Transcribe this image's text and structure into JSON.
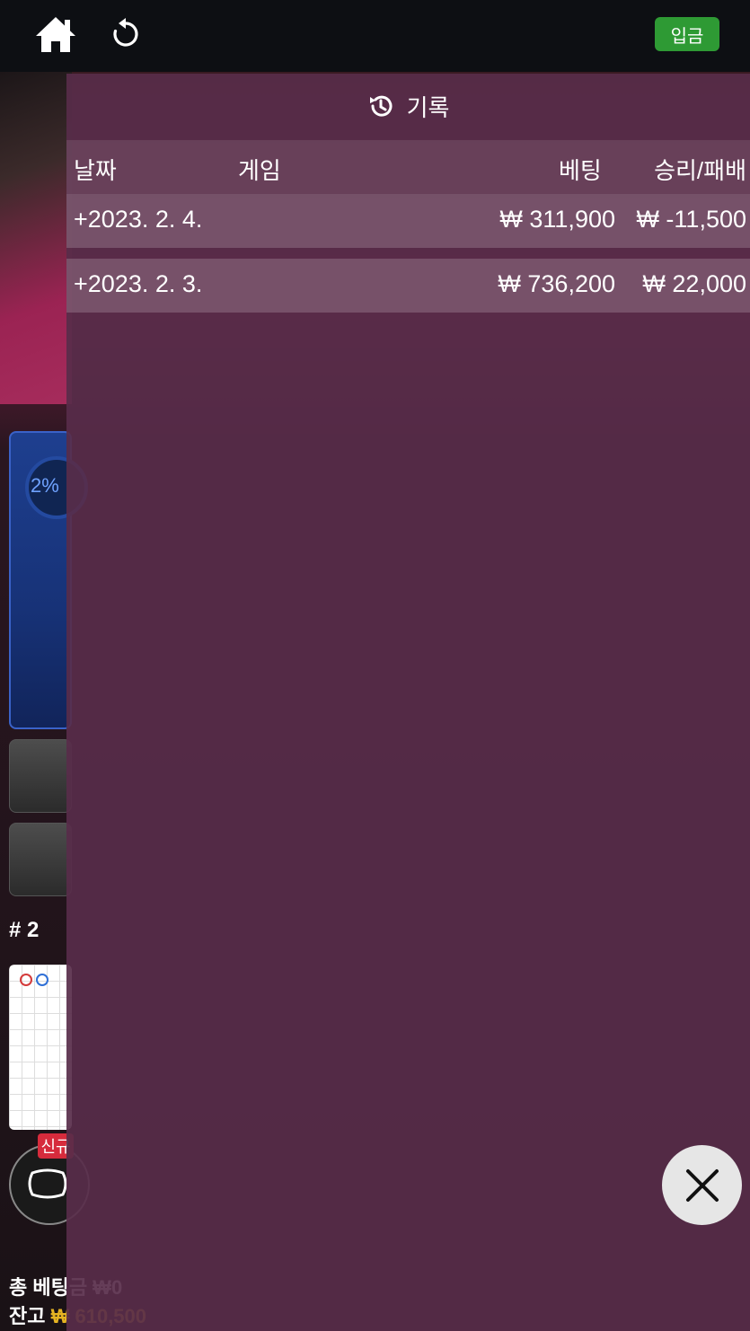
{
  "topbar": {
    "home_icon": "home-icon",
    "refresh_icon": "refresh-icon",
    "deposit_label": "입금",
    "deposit_color": "#2e9a34"
  },
  "background": {
    "player_percent": "2%",
    "round_label": "# 2",
    "new_badge": "신규",
    "total_bet_label": "총 베팅금 ₩0",
    "balance_label": "잔고",
    "balance_value": "₩ 610,500"
  },
  "history": {
    "title": "기록",
    "title_icon": "history-icon",
    "columns": {
      "date": "날짜",
      "game": "게임",
      "bet": "베팅",
      "winloss": "승리/패배"
    },
    "rows": [
      {
        "date": "+2023. 2. 4.",
        "bet": "₩ 311,900",
        "winloss": "₩ -11,500"
      },
      {
        "date": "+2023. 2. 3.",
        "bet": "₩ 736,200",
        "winloss": "₩ 22,000"
      }
    ]
  },
  "close_icon": "close-icon"
}
